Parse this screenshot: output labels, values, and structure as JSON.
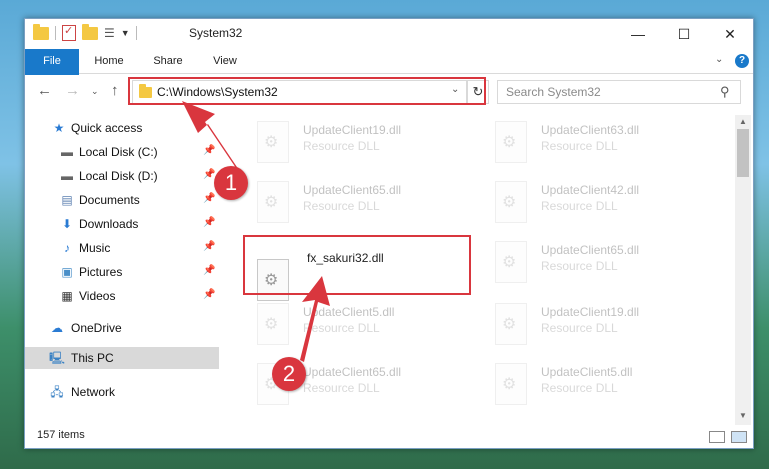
{
  "window": {
    "title": "System32",
    "controls": {
      "minimize": "—",
      "maximize": "☐",
      "close": "✕"
    }
  },
  "ribbon": {
    "tabs": [
      "File",
      "Home",
      "Share",
      "View"
    ],
    "help": "?"
  },
  "nav": {
    "address": "C:\\Windows\\System32",
    "search_placeholder": "Search System32"
  },
  "sidebar": {
    "items": [
      {
        "label": "Quick access",
        "icon": "star-icon"
      },
      {
        "label": "Local Disk (C:)",
        "icon": "drive-icon"
      },
      {
        "label": "Local Disk (D:)",
        "icon": "drive-icon"
      },
      {
        "label": "Documents",
        "icon": "documents-icon"
      },
      {
        "label": "Downloads",
        "icon": "download-icon"
      },
      {
        "label": "Music",
        "icon": "music-icon"
      },
      {
        "label": "Pictures",
        "icon": "pictures-icon"
      },
      {
        "label": "Videos",
        "icon": "videos-icon"
      },
      {
        "label": "OneDrive",
        "icon": "cloud-icon"
      },
      {
        "label": "This PC",
        "icon": "computer-icon"
      },
      {
        "label": "Network",
        "icon": "network-icon"
      }
    ],
    "selected": "This PC"
  },
  "files": [
    {
      "name": "UpdateClient19.dll",
      "type": "Resource DLL"
    },
    {
      "name": "UpdateClient63.dll",
      "type": "Resource DLL"
    },
    {
      "name": "UpdateClient65.dll",
      "type": "Resource DLL"
    },
    {
      "name": "UpdateClient42.dll",
      "type": "Resource DLL"
    },
    {
      "name": "fx_sakuri32.dll",
      "type": ""
    },
    {
      "name": "UpdateClient65.dll",
      "type": "Resource DLL"
    },
    {
      "name": "UpdateClient5.dll",
      "type": "Resource DLL"
    },
    {
      "name": "UpdateClient19.dll",
      "type": "Resource DLL"
    },
    {
      "name": "UpdateClient65.dll",
      "type": "Resource DLL"
    },
    {
      "name": "UpdateClient5.dll",
      "type": "Resource DLL"
    }
  ],
  "status": {
    "items_count": "157 items"
  },
  "annotations": {
    "step1": "1",
    "step2": "2",
    "color": "#d9363e"
  }
}
